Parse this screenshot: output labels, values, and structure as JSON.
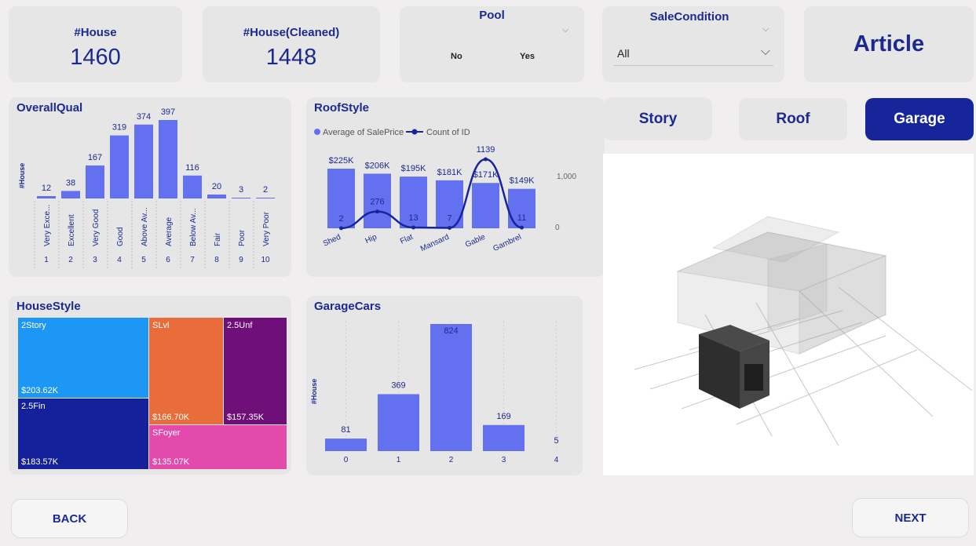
{
  "kpis": [
    {
      "title": "#House",
      "value": "1460"
    },
    {
      "title": "#House(Cleaned)",
      "value": "1448"
    }
  ],
  "pool": {
    "title": "Pool",
    "options": [
      "No",
      "Yes"
    ]
  },
  "sale_condition": {
    "title": "SaleCondition",
    "selected": "All"
  },
  "article_label": "Article",
  "tabs": {
    "story": "Story",
    "roof": "Roof",
    "garage": "Garage",
    "active": "Garage"
  },
  "nav": {
    "back": "BACK",
    "next": "NEXT"
  },
  "colors": {
    "bar": "#6370f0",
    "line": "#17259a",
    "accent": "#1b2a8f",
    "active_tab": "#17259a"
  },
  "icons": {
    "model": "3d-house-model-garage"
  },
  "chart_data": [
    {
      "type": "bar",
      "title": "OverallQual",
      "ylabel": "#House",
      "categories": [
        "1",
        "2",
        "3",
        "4",
        "5",
        "6",
        "7",
        "8",
        "9",
        "10"
      ],
      "sublabels": [
        "Very Exce...",
        "Excellent",
        "Very Good",
        "Good",
        "Above Av...",
        "Average",
        "Below Av...",
        "Fair",
        "Poor",
        "Very Poor"
      ],
      "values": [
        12,
        38,
        167,
        319,
        374,
        397,
        116,
        20,
        3,
        2
      ],
      "ylim": [
        0,
        397
      ]
    },
    {
      "type": "bar",
      "title": "RoofStyle",
      "legend": [
        "Average of SalePrice",
        "Count of ID"
      ],
      "categories": [
        "Shed",
        "Hip",
        "Flat",
        "Mansard",
        "Gable",
        "Gambrel"
      ],
      "bar_labels": [
        "$225K",
        "$206K",
        "$195K",
        "$181K",
        "$171K",
        "$149K"
      ],
      "bar_values": [
        225,
        206,
        195,
        181,
        171,
        149
      ],
      "line_values": [
        2,
        276,
        13,
        7,
        1139,
        11
      ],
      "y2_ticks": [
        "1,000",
        "0"
      ],
      "ylim": [
        0,
        225
      ],
      "y2lim": [
        0,
        1139
      ]
    },
    {
      "type": "treemap",
      "title": "HouseStyle",
      "items": [
        {
          "label": "2Story",
          "value": "$203.62K",
          "color": "#1c97f5"
        },
        {
          "label": "2.5Fin",
          "value": "$183.57K",
          "color": "#14219a"
        },
        {
          "label": "SLvl",
          "value": "$166.70K",
          "color": "#e86d3a"
        },
        {
          "label": "2.5Unf",
          "value": "$157.35K",
          "color": "#6f0f7a"
        },
        {
          "label": "SFoyer",
          "value": "$135.07K",
          "color": "#e44aac"
        }
      ]
    },
    {
      "type": "bar",
      "title": "GarageCars",
      "ylabel": "#House",
      "categories": [
        "0",
        "1",
        "2",
        "3",
        "4"
      ],
      "values": [
        81,
        369,
        824,
        169,
        5
      ],
      "ylim": [
        0,
        824
      ]
    }
  ]
}
